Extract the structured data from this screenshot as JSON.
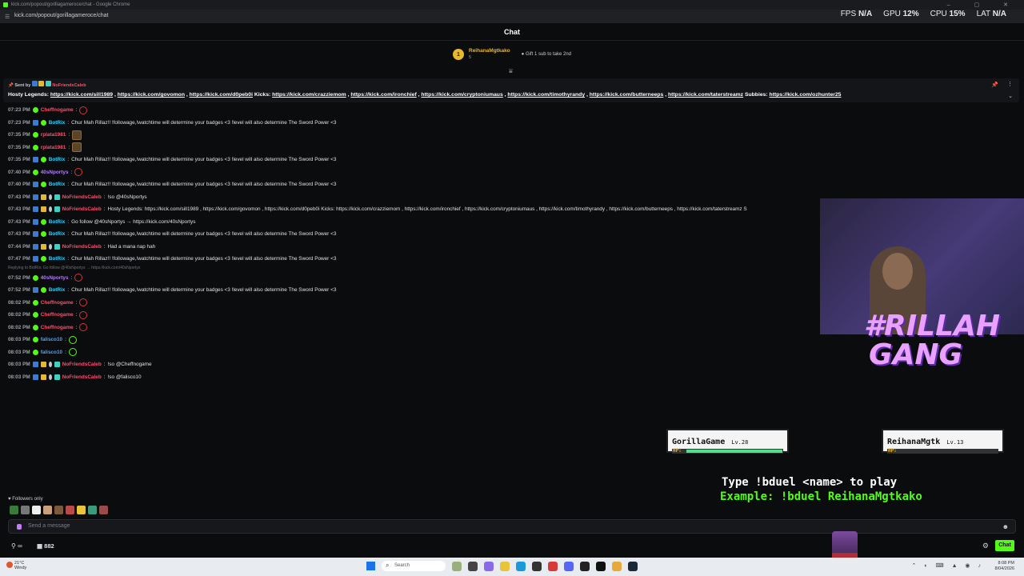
{
  "browser": {
    "tab_title": "kick.com/popout/gorillagameroce/chat - Google Chrome",
    "url": "kick.com/popout/gorillagameroce/chat",
    "window_controls": "– ▢ ✕"
  },
  "stats": {
    "fps_label": "FPS",
    "fps_value": "N/A",
    "gpu_label": "GPU",
    "gpu_value": "12%",
    "cpu_label": "CPU",
    "cpu_value": "15%",
    "lat_label": "LAT",
    "lat_value": "N/A"
  },
  "chat_header": {
    "title": "Chat"
  },
  "sub_leader": {
    "rank": "1",
    "name": "ReihanaMgtkako",
    "count": "5",
    "gift_text": "Gift 1 sub to take 2nd"
  },
  "pinned": {
    "sent_by_label": "Sent by",
    "sender": "NoFriendsCaleb",
    "prefix": "Hosty Legends:",
    "links1": [
      "https://kick.com/sill1989",
      "https://kick.com/govomon",
      "https://kick.com/d0peb0i"
    ],
    "kicks_label": "Kicks:",
    "links2": [
      "https://kick.com/crazziemom",
      "https://kick.com/ironchief",
      "https://kick.com/cryptoniumaus",
      "https://kick.com/timothyrandy",
      "https://kick.com/butterneeps",
      "https://kick.com/taterstreamz"
    ],
    "subbies_label": "Subbies:",
    "links3": [
      "https://kick.com/ozhunter25"
    ]
  },
  "messages": [
    {
      "time": "07:23 PM",
      "user": "Cheffnogame",
      "text": "",
      "color": "red"
    },
    {
      "time": "07:23 PM",
      "user": "BotRix",
      "text": "Chur Mah Rillaz!! !followage,!watchtime will determine your badges <3 !level will also determine The Sword Power <3",
      "color": "bluebot"
    },
    {
      "time": "07:35 PM",
      "user": "rplata1981",
      "text": "",
      "color": "red"
    },
    {
      "time": "07:35 PM",
      "user": "rplata1981",
      "text": "",
      "color": "red"
    },
    {
      "time": "07:35 PM",
      "user": "BotRix",
      "text": "Chur Mah Rillaz!! !followage,!watchtime will determine your badges <3 !level will also determine The Sword Power <3",
      "color": "bluebot"
    },
    {
      "time": "07:40 PM",
      "user": "40sNportys",
      "text": "",
      "color": "purple"
    },
    {
      "time": "07:40 PM",
      "user": "BotRix",
      "text": "Chur Mah Rillaz!! !followage,!watchtime will determine your badges <3 !level will also determine The Sword Power <3",
      "color": "bluebot"
    },
    {
      "time": "07:43 PM",
      "user": "NoFriendsCaleb",
      "text": "!so @40sNportys",
      "color": "red"
    },
    {
      "time": "07:43 PM",
      "user": "NoFriendsCaleb",
      "text": "Hosty Legends: https://kick.com/sill1989 , https://kick.com/govomon , https://kick.com/d0peb0i Kicks: https://kick.com/crazziemom , https://kick.com/ironchief , https://kick.com/cryptoniumaus , https://kick.com/timothyrandy , https://kick.com/butterneeps , https://kick.com/taterstreamz S",
      "color": "red"
    },
    {
      "time": "07:43 PM",
      "user": "BotRix",
      "text": "Go follow @40sNportys → https://kick.com/40sNportys",
      "color": "bluebot"
    },
    {
      "time": "07:43 PM",
      "user": "BotRix",
      "text": "Chur Mah Rillaz!! !followage,!watchtime will determine your badges <3 !level will also determine The Sword Power <3",
      "color": "bluebot"
    },
    {
      "time": "07:44 PM",
      "user": "NoFriendsCaleb",
      "text": "Had a mana nap hah",
      "color": "red"
    },
    {
      "time": "07:47 PM",
      "user": "BotRix",
      "text": "Chur Mah Rillaz!! !followage,!watchtime will determine your badges <3 !level will also determine The Sword Power <3",
      "color": "bluebot"
    }
  ],
  "reply_note": "Replying to BotRix: Go follow @40sNportys → https://kick.com/40sNportys",
  "messages2": [
    {
      "time": "07:52 PM",
      "user": "40sNportys",
      "text": "",
      "color": "purple"
    },
    {
      "time": "07:52 PM",
      "user": "BotRix",
      "text": "Chur Mah Rillaz!! !followage,!watchtime will determine your badges <3 !level will also determine The Sword Power <3",
      "color": "bluebot"
    },
    {
      "time": "08:02 PM",
      "user": "Cheffnogame",
      "text": "",
      "color": "red"
    },
    {
      "time": "08:02 PM",
      "user": "Cheffnogame",
      "text": "",
      "color": "red"
    },
    {
      "time": "08:02 PM",
      "user": "Cheffnogame",
      "text": "",
      "color": "red"
    },
    {
      "time": "08:03 PM",
      "user": "falisco10",
      "text": "",
      "color": "blue"
    },
    {
      "time": "08:03 PM",
      "user": "falisco10",
      "text": "",
      "color": "blue"
    },
    {
      "time": "08:03 PM",
      "user": "NoFriendsCaleb",
      "text": "!so @Cheffnogame",
      "color": "red"
    },
    {
      "time": "08:03 PM",
      "user": "NoFriendsCaleb",
      "text": "!so @falisco10",
      "color": "red"
    }
  ],
  "overlay": {
    "logo_line1": "#RILLAH",
    "logo_line2": "GANG",
    "player1": {
      "name": "GorillaGame",
      "level": "Lv.28",
      "hp_label": "HP:",
      "hp_fraction": 0.92
    },
    "player2": {
      "name": "ReihanaMgtk",
      "level": "Lv.13",
      "hp_label": "HP:",
      "hp_fraction": 0.0
    },
    "duel_line1": "Type !bduel <name> to play",
    "duel_line2": "Example: !bduel ReihanaMgtkako"
  },
  "footer": {
    "followers_only": "Followers only",
    "input_placeholder": "Send a message",
    "points": "882",
    "infinity": "∞",
    "chat_button": "Chat"
  },
  "taskbar": {
    "weather_temp": "21°C",
    "weather_desc": "Windy",
    "search_label": "Search",
    "time": "8:08 PM",
    "date": "8/04/2026"
  },
  "colors": {
    "kick_green": "#53fc18",
    "user_red": "#ff4d6d",
    "bot_blue": "#2fd1ff",
    "gold": "#e8b730"
  }
}
